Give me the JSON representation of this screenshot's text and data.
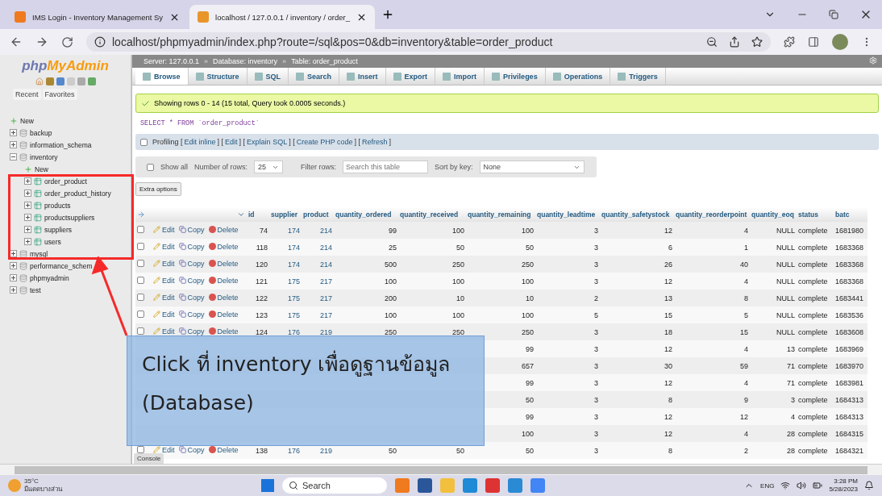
{
  "browser": {
    "tabs": [
      {
        "title": "IMS Login - Inventory Management Sy",
        "selected": false
      },
      {
        "title": "localhost / 127.0.0.1 / inventory / order_",
        "selected": true
      }
    ],
    "url": "localhost/phpmyadmin/index.php?route=/sql&pos=0&db=inventory&table=order_product"
  },
  "sidebar": {
    "logo": {
      "part_1": "php",
      "part_2": "MyAdmin"
    },
    "tabs": [
      "Recent",
      "Favorites"
    ],
    "tree": [
      {
        "label": "New",
        "kind": "new"
      },
      {
        "label": "backup",
        "kind": "db",
        "expanded": false
      },
      {
        "label": "information_schema",
        "kind": "db",
        "expanded": false
      },
      {
        "label": "inventory",
        "kind": "db",
        "expanded": true,
        "children": [
          {
            "label": "New",
            "kind": "new"
          },
          {
            "label": "order_product",
            "kind": "table",
            "expanded": false
          },
          {
            "label": "order_product_history",
            "kind": "table",
            "expanded": false
          },
          {
            "label": "products",
            "kind": "table",
            "expanded": false
          },
          {
            "label": "productsuppliers",
            "kind": "table",
            "expanded": false
          },
          {
            "label": "suppliers",
            "kind": "table",
            "expanded": false
          },
          {
            "label": "users",
            "kind": "table",
            "expanded": false
          }
        ]
      },
      {
        "label": "mysql",
        "kind": "db",
        "expanded": false
      },
      {
        "label": "performance_schem",
        "kind": "db",
        "expanded": false
      },
      {
        "label": "phpmyadmin",
        "kind": "db",
        "expanded": false
      },
      {
        "label": "test",
        "kind": "db",
        "expanded": false
      }
    ]
  },
  "breadcrumb": [
    {
      "text": "Server: 127.0.0.1",
      "separator": "»"
    },
    {
      "text": "Database: inventory",
      "separator": "»"
    },
    {
      "text": "Table: order_product"
    }
  ],
  "tabs": [
    {
      "label": "Browse",
      "selected": true
    },
    {
      "label": "Structure",
      "selected": false
    },
    {
      "label": "SQL",
      "selected": false
    },
    {
      "label": "Search",
      "selected": false
    },
    {
      "label": "Insert",
      "selected": false
    },
    {
      "label": "Export",
      "selected": false
    },
    {
      "label": "Import",
      "selected": false
    },
    {
      "label": "Privileges",
      "selected": false
    },
    {
      "label": "Operations",
      "selected": false
    },
    {
      "label": "Triggers",
      "selected": false
    }
  ],
  "message": "Showing rows 0 - 14 (15 total, Query took 0.0005 seconds.)",
  "query": "SELECT * FROM `order_product`",
  "profiling": {
    "checked": false,
    "segments": [
      {
        "kind": "text",
        "text": "Profiling ["
      },
      {
        "kind": "link",
        "text": "Edit inline"
      },
      {
        "kind": "text",
        "text": "] ["
      },
      {
        "kind": "link",
        "text": "Edit"
      },
      {
        "kind": "text",
        "text": "] ["
      },
      {
        "kind": "link",
        "text": "Explain SQL"
      },
      {
        "kind": "text",
        "text": "] ["
      },
      {
        "kind": "link",
        "text": "Create PHP code"
      },
      {
        "kind": "text",
        "text": "] ["
      },
      {
        "kind": "link",
        "text": "Refresh"
      },
      {
        "kind": "text",
        "text": "]"
      }
    ]
  },
  "filters": {
    "show_all": {
      "label": "Show all",
      "checked": false
    },
    "rows_label": "Number of rows:",
    "rows_value": "25",
    "filter_label": "Filter rows:",
    "filter_placeholder": "Search this table",
    "sort_label": "Sort by key:",
    "sort_value": "None"
  },
  "extra_options": "Extra options",
  "table": {
    "columns": [
      "id",
      "supplier",
      "product",
      "quantity_ordered",
      "quantity_received",
      "quantity_remaining",
      "quantity_leadtime",
      "quantity_safetystock",
      "quantity_reorderpoint",
      "quantity_eoq",
      "status",
      "batc"
    ],
    "rows": [
      {
        "checked": false,
        "actions": [
          "Edit",
          "Copy",
          "Delete"
        ],
        "cells": [
          "74",
          "174",
          "214",
          "99",
          "100",
          "100",
          "3",
          "12",
          "4",
          "NULL",
          "complete",
          "1681980"
        ]
      },
      {
        "checked": false,
        "actions": [
          "Edit",
          "Copy",
          "Delete"
        ],
        "cells": [
          "118",
          "174",
          "214",
          "25",
          "50",
          "50",
          "3",
          "6",
          "1",
          "NULL",
          "complete",
          "1683368"
        ]
      },
      {
        "checked": false,
        "actions": [
          "Edit",
          "Copy",
          "Delete"
        ],
        "cells": [
          "120",
          "174",
          "214",
          "500",
          "250",
          "250",
          "3",
          "26",
          "40",
          "NULL",
          "complete",
          "1683368"
        ]
      },
      {
        "checked": false,
        "actions": [
          "Edit",
          "Copy",
          "Delete"
        ],
        "cells": [
          "121",
          "175",
          "217",
          "100",
          "100",
          "100",
          "3",
          "12",
          "4",
          "NULL",
          "complete",
          "1683368"
        ]
      },
      {
        "checked": false,
        "actions": [
          "Edit",
          "Copy",
          "Delete"
        ],
        "cells": [
          "122",
          "175",
          "217",
          "200",
          "10",
          "10",
          "2",
          "13",
          "8",
          "NULL",
          "complete",
          "1683441"
        ]
      },
      {
        "checked": false,
        "actions": [
          "Edit",
          "Copy",
          "Delete"
        ],
        "cells": [
          "123",
          "175",
          "217",
          "100",
          "100",
          "100",
          "5",
          "15",
          "5",
          "NULL",
          "complete",
          "1683536"
        ]
      },
      {
        "checked": false,
        "actions": [
          "Edit",
          "Copy",
          "Delete"
        ],
        "cells": [
          "124",
          "176",
          "219",
          "250",
          "250",
          "250",
          "3",
          "18",
          "15",
          "NULL",
          "complete",
          "1683608"
        ]
      },
      {
        "cells": [
          "99",
          "3",
          "12",
          "4",
          "13",
          "complete",
          "1683969"
        ]
      },
      {
        "cells": [
          "657",
          "3",
          "30",
          "59",
          "71",
          "complete",
          "1683970"
        ]
      },
      {
        "cells": [
          "99",
          "3",
          "12",
          "4",
          "71",
          "complete",
          "1683981"
        ]
      },
      {
        "cells": [
          "50",
          "3",
          "8",
          "9",
          "3",
          "complete",
          "1684313"
        ]
      },
      {
        "cells": [
          "99",
          "3",
          "12",
          "12",
          "4",
          "complete",
          "1684313"
        ]
      },
      {
        "cells": [
          "100",
          "3",
          "12",
          "4",
          "28",
          "complete",
          "1684315"
        ]
      },
      {
        "checked": false,
        "actions": [
          "Edit",
          "Copy",
          "Delete"
        ],
        "cells": [
          "138",
          "176",
          "219",
          "50",
          "50",
          "50",
          "3",
          "8",
          "2",
          "28",
          "complete",
          "1684321"
        ]
      }
    ]
  },
  "console": "Console",
  "annotation": {
    "lines": [
      "Click ที่ inventory เพื่อดูฐานข้อมูล",
      "(Database)"
    ]
  },
  "taskbar": {
    "temperature": "35°C",
    "weather": "มีแดดบางส่วน",
    "search": "Search",
    "language": "ENG",
    "time": "3:28 PM",
    "date": "5/28/2023"
  }
}
